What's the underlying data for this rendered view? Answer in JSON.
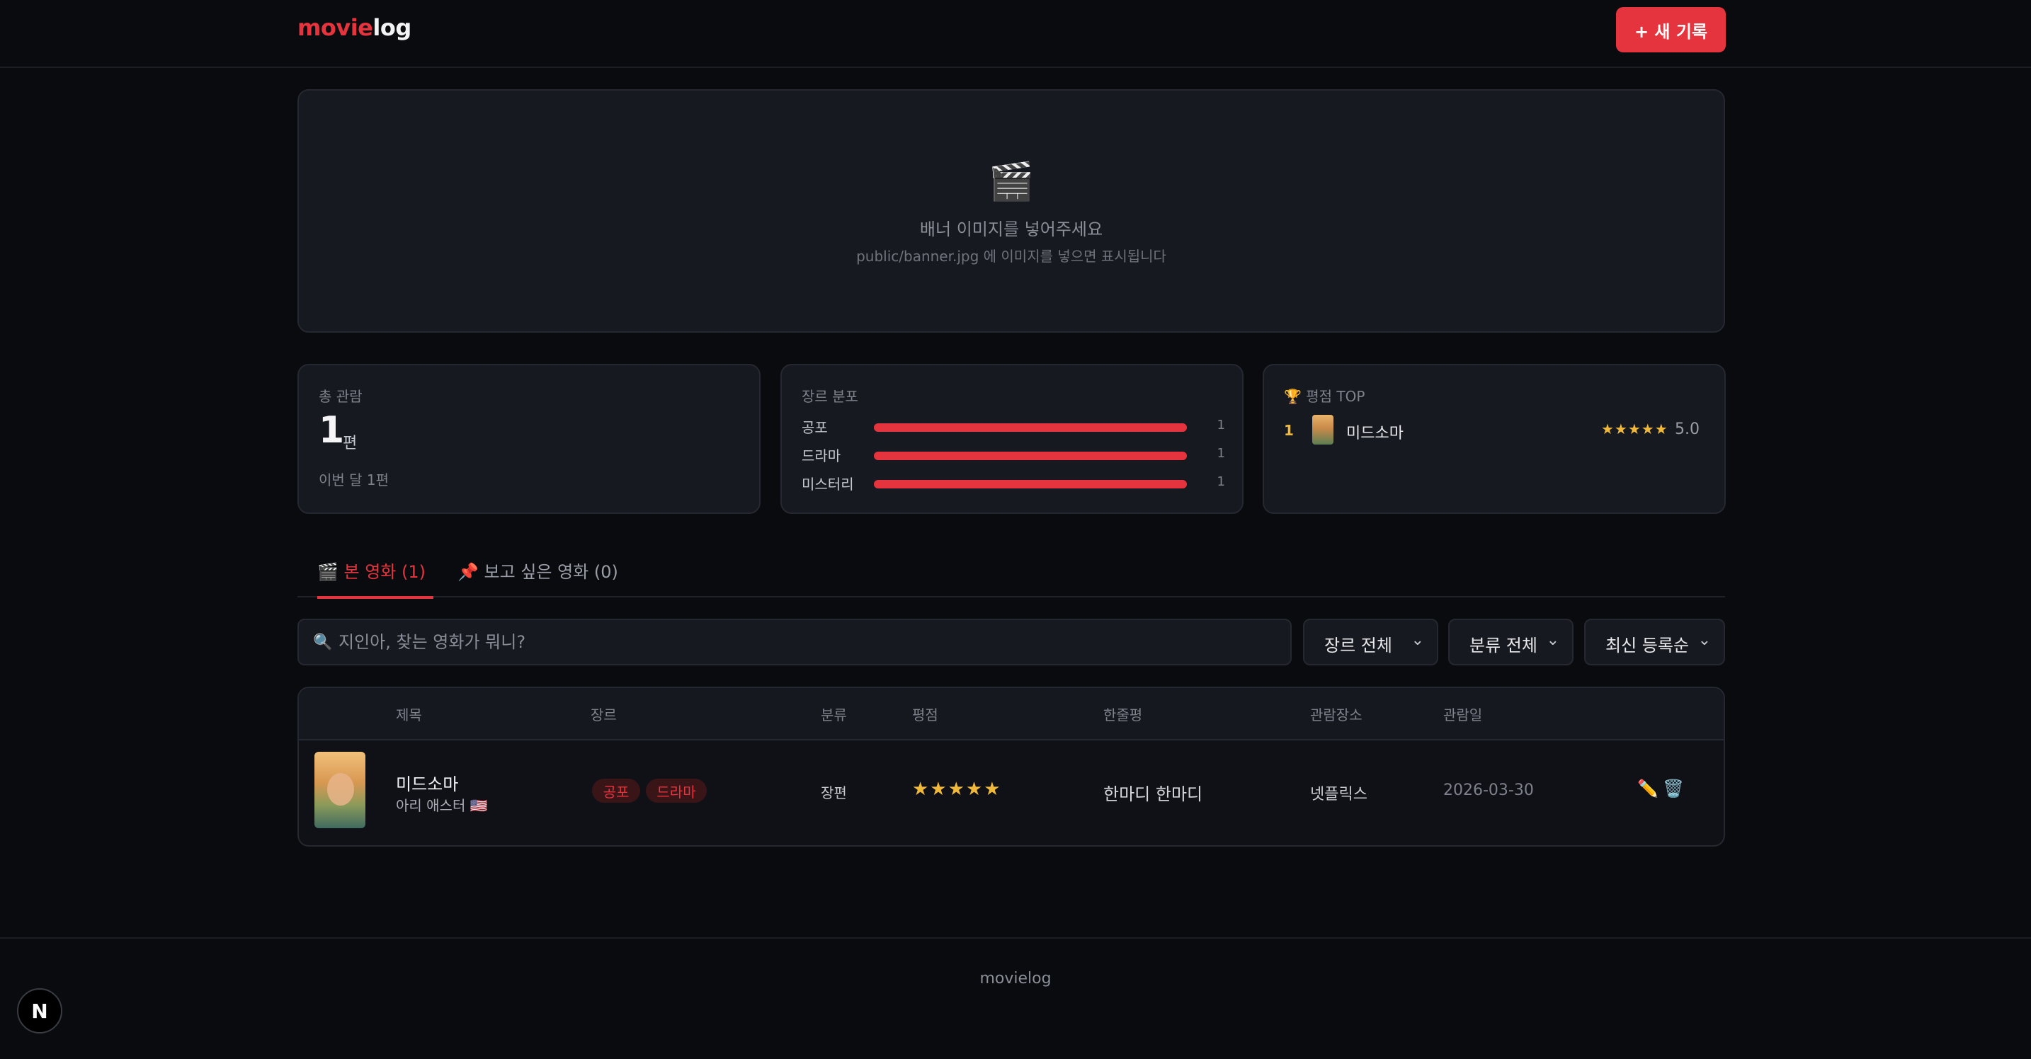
{
  "header": {
    "logo_a": "movie",
    "logo_b": "log",
    "new_button": "+ 새 기록"
  },
  "banner": {
    "icon": "🎬",
    "title": "배너 이미지를 넣어주세요",
    "subtitle": "public/banner.jpg 에 이미지를 넣으면 표시됩니다"
  },
  "stats": {
    "total": {
      "label": "총 관람",
      "count": "1",
      "unit": "편",
      "month": "이번 달 1편"
    },
    "genres": {
      "label": "장르 분포",
      "items": [
        {
          "name": "공포",
          "count": "1",
          "fraction": 1.0
        },
        {
          "name": "드라마",
          "count": "1",
          "fraction": 1.0
        },
        {
          "name": "미스터리",
          "count": "1",
          "fraction": 1.0
        }
      ]
    },
    "top": {
      "label": "🏆 평점 TOP",
      "rank": "1",
      "title": "미드소마",
      "stars": "★★★★★",
      "score": "5.0"
    }
  },
  "tabs": [
    {
      "label": "🎬 본 영화 (1)",
      "active": true
    },
    {
      "label": "📌 보고 싶은 영화 (0)",
      "active": false
    }
  ],
  "search": {
    "icon": "search-icon",
    "placeholder": "지인아, 찾는 영화가 뭐니?"
  },
  "filters": {
    "genre": "장르 전체",
    "category": "분류 전체",
    "sort": "최신 등록순",
    "chevron": "⌄"
  },
  "table": {
    "headers": [
      "제목",
      "장르",
      "분류",
      "평점",
      "한줄평",
      "관람장소",
      "관람일"
    ],
    "rows": [
      {
        "title": "미드소마",
        "director": "아리 애스터 🇺🇸",
        "tags": [
          "공포",
          "드라마"
        ],
        "category": "장편",
        "stars": "★★★★★",
        "review": "한마디 한마디",
        "place": "넷플릭스",
        "date": "2026-03-30",
        "edit_icon": "✏️",
        "delete_icon": "🗑️"
      }
    ]
  },
  "footer": {
    "text": "movielog"
  },
  "badge": {
    "text": "N"
  },
  "colors": {
    "accent": "#e5343d",
    "star": "#f0b93a",
    "background": "#0a0b0e",
    "card": "#171920"
  }
}
